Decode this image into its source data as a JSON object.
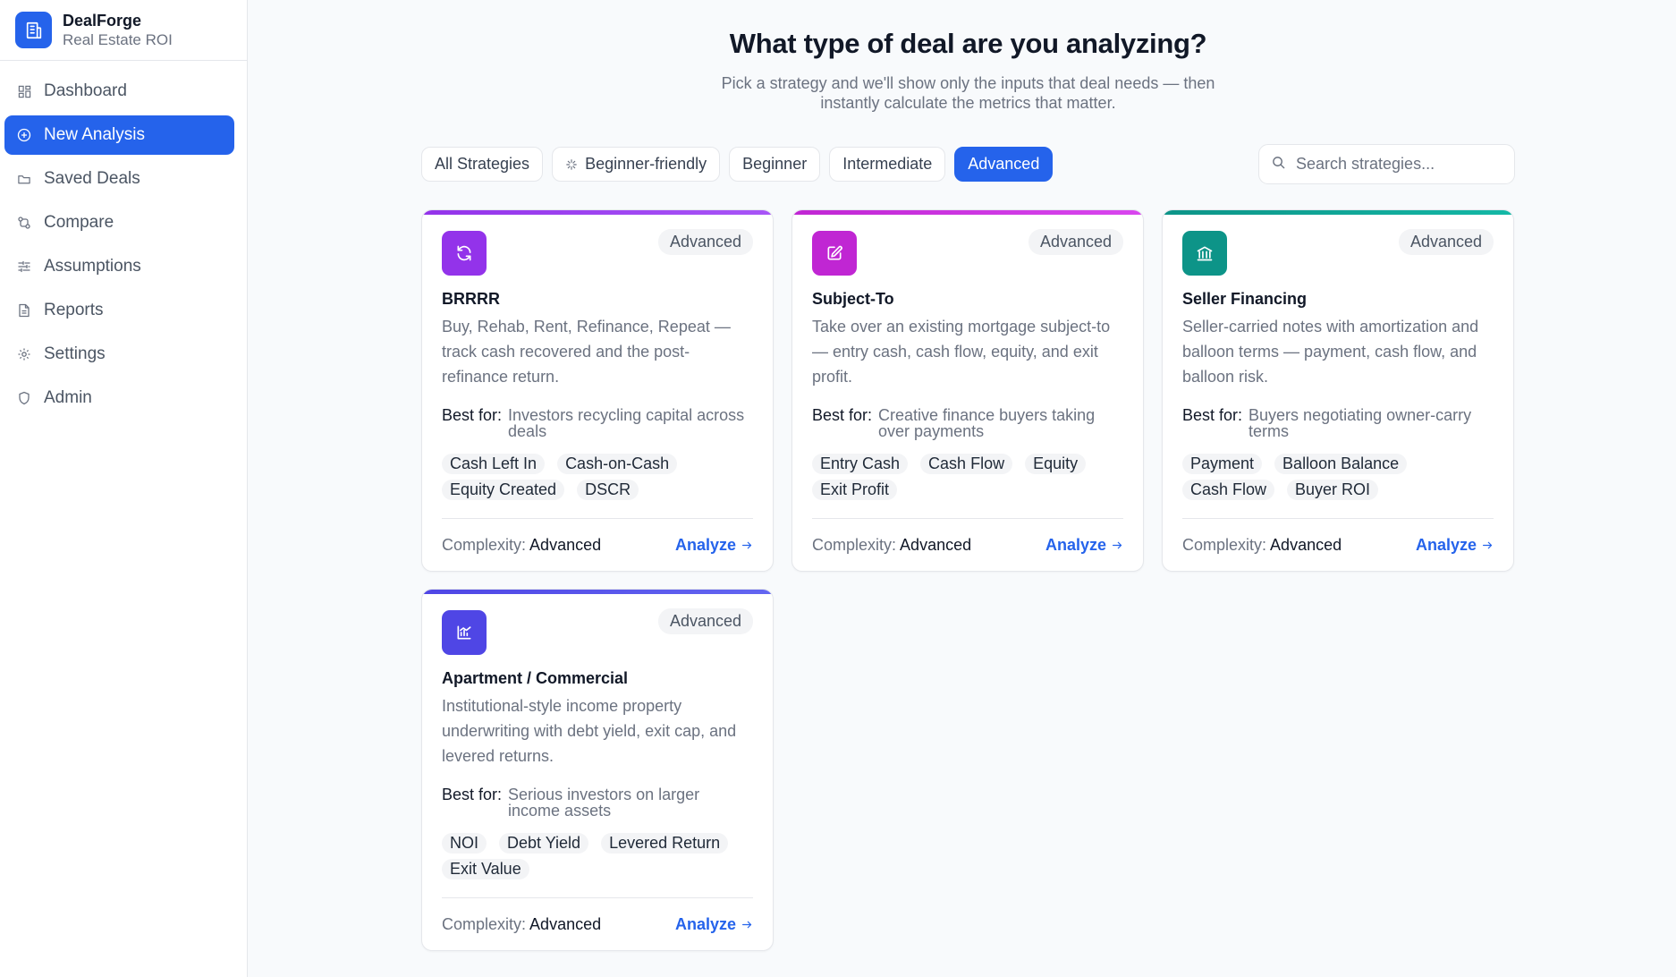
{
  "app": {
    "name": "DealForge",
    "subtitle": "Real Estate ROI"
  },
  "sidebar": {
    "items": [
      {
        "label": "Dashboard",
        "icon": "dashboard-icon",
        "active": false
      },
      {
        "label": "New Analysis",
        "icon": "plus-circle-icon",
        "active": true
      },
      {
        "label": "Saved Deals",
        "icon": "folder-icon",
        "active": false
      },
      {
        "label": "Compare",
        "icon": "compare-icon",
        "active": false
      },
      {
        "label": "Assumptions",
        "icon": "sliders-icon",
        "active": false
      },
      {
        "label": "Reports",
        "icon": "file-icon",
        "active": false
      },
      {
        "label": "Settings",
        "icon": "gear-icon",
        "active": false
      },
      {
        "label": "Admin",
        "icon": "shield-icon",
        "active": false
      }
    ]
  },
  "header": {
    "title": "What type of deal are you analyzing?",
    "subtitle": "Pick a strategy and we'll show only the inputs that deal needs — then instantly calculate the metrics that matter."
  },
  "filters": [
    {
      "label": "All Strategies",
      "active": false
    },
    {
      "label": "Beginner-friendly",
      "active": false,
      "icon": "sparkle-icon"
    },
    {
      "label": "Beginner",
      "active": false
    },
    {
      "label": "Intermediate",
      "active": false
    },
    {
      "label": "Advanced",
      "active": true
    }
  ],
  "search": {
    "placeholder": "Search strategies..."
  },
  "colors": {
    "accent": "#2563eb",
    "purple": "#9333ea",
    "magenta": "#c026d3",
    "teal": "#0d9488",
    "indigo": "#4f46e5"
  },
  "cards": [
    {
      "title": "BRRRR",
      "badge": "Advanced",
      "description": "Buy, Rehab, Rent, Refinance, Repeat — track cash recovered and the post-refinance return.",
      "best_for_label": "Best for:",
      "best_for": "Investors recycling capital across deals",
      "tags": [
        "Cash Left In",
        "Cash-on-Cash",
        "Equity Created",
        "DSCR"
      ],
      "complexity_label": "Complexity:",
      "complexity": "Advanced",
      "action": "Analyze",
      "icon": "refresh-icon"
    },
    {
      "title": "Subject-To",
      "badge": "Advanced",
      "description": "Take over an existing mortgage subject-to — entry cash, cash flow, equity, and exit profit.",
      "best_for_label": "Best for:",
      "best_for": "Creative finance buyers taking over payments",
      "tags": [
        "Entry Cash",
        "Cash Flow",
        "Equity",
        "Exit Profit"
      ],
      "complexity_label": "Complexity:",
      "complexity": "Advanced",
      "action": "Analyze",
      "icon": "edit-document-icon"
    },
    {
      "title": "Seller Financing",
      "badge": "Advanced",
      "description": "Seller-carried notes with amortization and balloon terms — payment, cash flow, and balloon risk.",
      "best_for_label": "Best for:",
      "best_for": "Buyers negotiating owner-carry terms",
      "tags": [
        "Payment",
        "Balloon Balance",
        "Cash Flow",
        "Buyer ROI"
      ],
      "complexity_label": "Complexity:",
      "complexity": "Advanced",
      "action": "Analyze",
      "icon": "bank-icon"
    },
    {
      "title": "Apartment / Commercial",
      "badge": "Advanced",
      "description": "Institutional-style income property underwriting with debt yield, exit cap, and levered returns.",
      "best_for_label": "Best for:",
      "best_for": "Serious investors on larger income assets",
      "tags": [
        "NOI",
        "Debt Yield",
        "Levered Return",
        "Exit Value"
      ],
      "complexity_label": "Complexity:",
      "complexity": "Advanced",
      "action": "Analyze",
      "icon": "chart-icon"
    }
  ]
}
